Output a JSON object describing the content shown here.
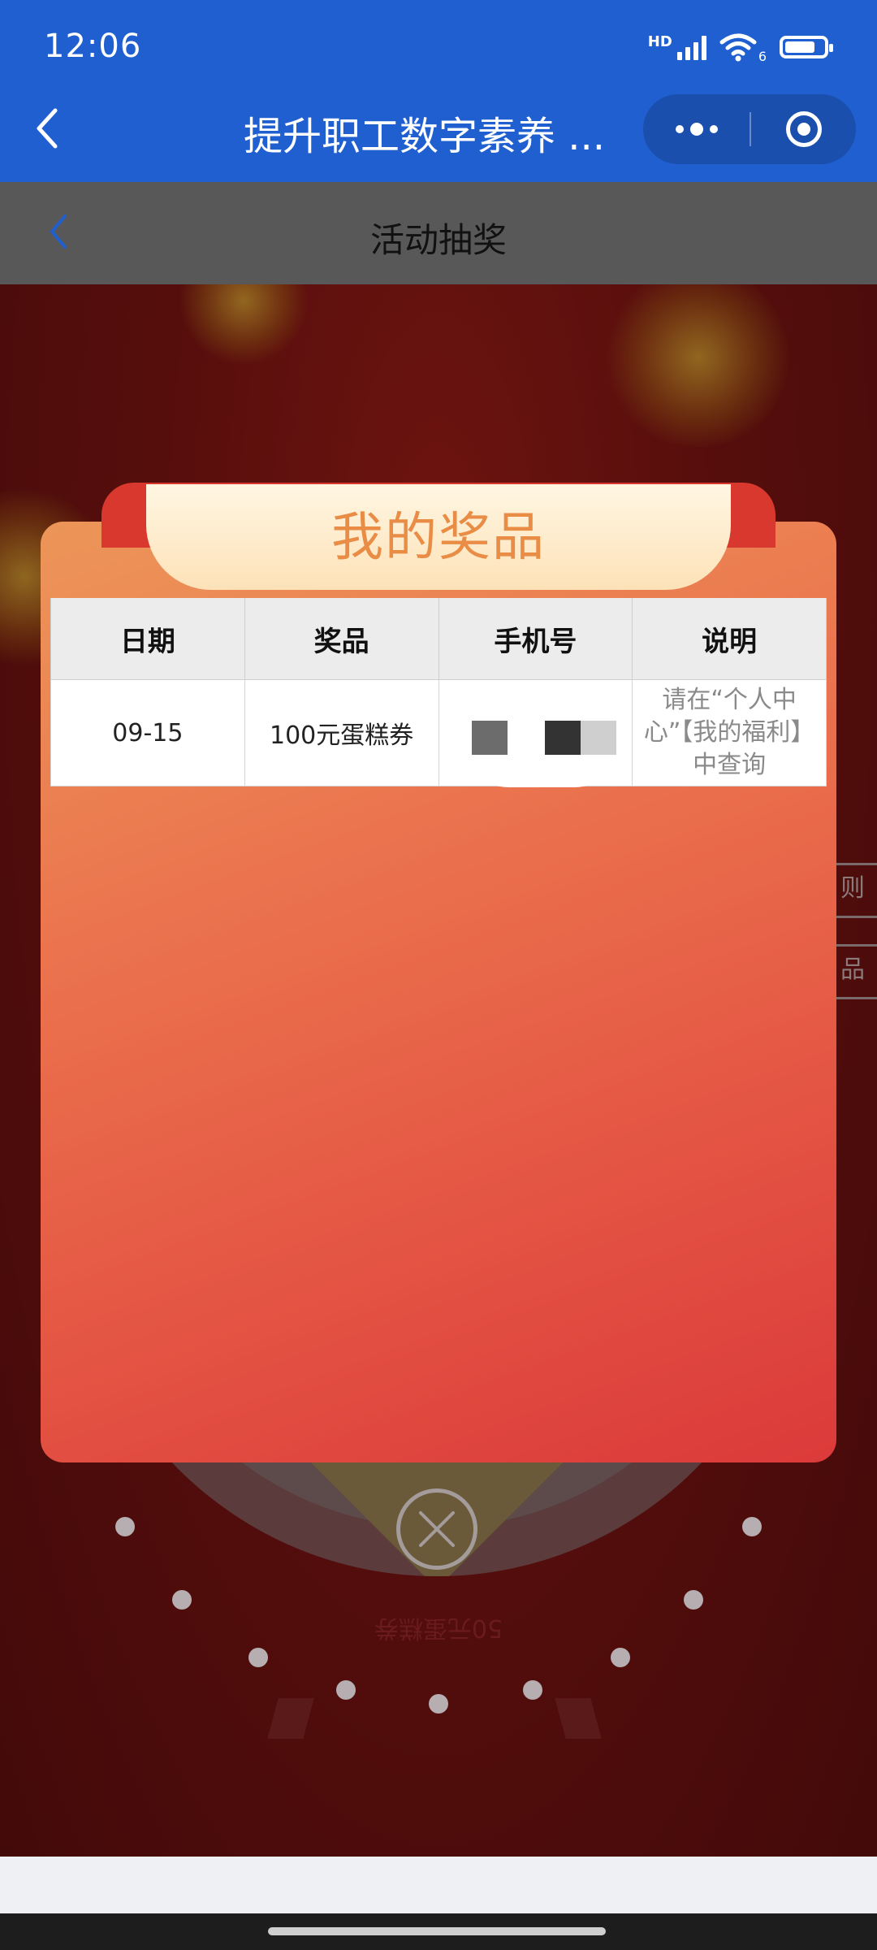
{
  "status_bar": {
    "time": "12:06",
    "network_label": "HD",
    "wifi_badge": "6"
  },
  "nav": {
    "title": "提升职工数字素养 ..."
  },
  "page": {
    "title": "活动抽奖"
  },
  "modal": {
    "title": "我的奖品",
    "columns": [
      "日期",
      "奖品",
      "手机号",
      "说明"
    ],
    "rows": [
      {
        "date": "09-15",
        "prize": "100元蛋糕券",
        "phone": "",
        "note": "请在“个人中心”【我的福利】中查询"
      }
    ]
  },
  "background": {
    "wheel_prize_label": "50元蛋糕券",
    "side_button_1": "则",
    "side_button_2": "品"
  },
  "colors": {
    "nav_blue": "#1f5fd0",
    "modal_title": "#e98d46",
    "modal_red": "#db3a3a"
  }
}
